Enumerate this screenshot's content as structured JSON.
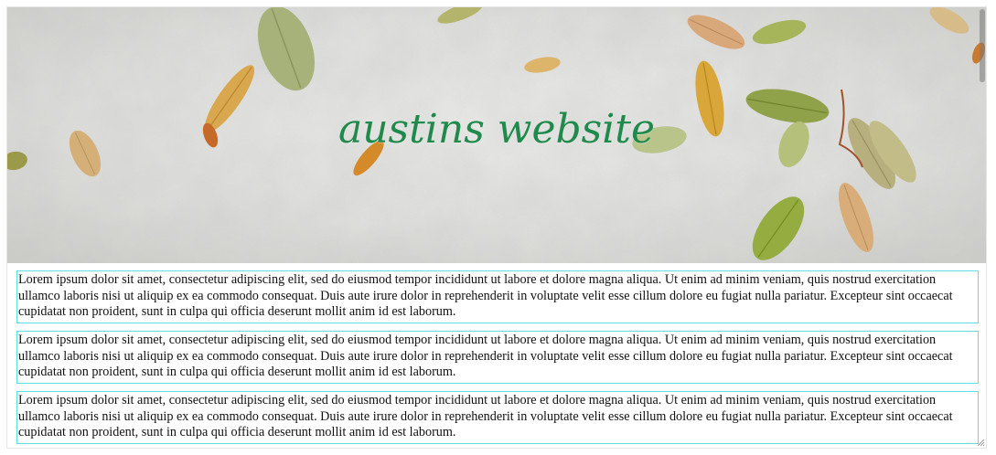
{
  "header": {
    "title": "austins website"
  },
  "main": {
    "paragraphs": [
      "Lorem ipsum dolor sit amet, consectetur adipiscing elit, sed do eiusmod tempor incididunt ut labore et dolore magna aliqua. Ut enim ad minim veniam, quis nostrud exercitation ullamco laboris nisi ut aliquip ex ea commodo consequat. Duis aute irure dolor in reprehenderit in voluptate velit esse cillum dolore eu fugiat nulla pariatur. Excepteur sint occaecat cupidatat non proident, sunt in culpa qui officia deserunt mollit anim id est laborum.",
      "Lorem ipsum dolor sit amet, consectetur adipiscing elit, sed do eiusmod tempor incididunt ut labore et dolore magna aliqua. Ut enim ad minim veniam, quis nostrud exercitation ullamco laboris nisi ut aliquip ex ea commodo consequat. Duis aute irure dolor in reprehenderit in voluptate velit esse cillum dolore eu fugiat nulla pariatur. Excepteur sint occaecat cupidatat non proident, sunt in culpa qui officia deserunt mollit anim id est laborum.",
      "Lorem ipsum dolor sit amet, consectetur adipiscing elit, sed do eiusmod tempor incididunt ut labore et dolore magna aliqua. Ut enim ad minim veniam, quis nostrud exercitation ullamco laboris nisi ut aliquip ex ea commodo consequat. Duis aute irure dolor in reprehenderit in voluptate velit esse cillum dolore eu fugiat nulla pariatur. Excepteur sint occaecat cupidatat non proident, sunt in culpa qui officia deserunt mollit anim id est laborum."
    ]
  },
  "colors": {
    "title": "#1f8a4c",
    "box_border": "#5fe0e0",
    "text": "#111111"
  },
  "hero_image": {
    "icon": "leaves-on-snow-image"
  }
}
